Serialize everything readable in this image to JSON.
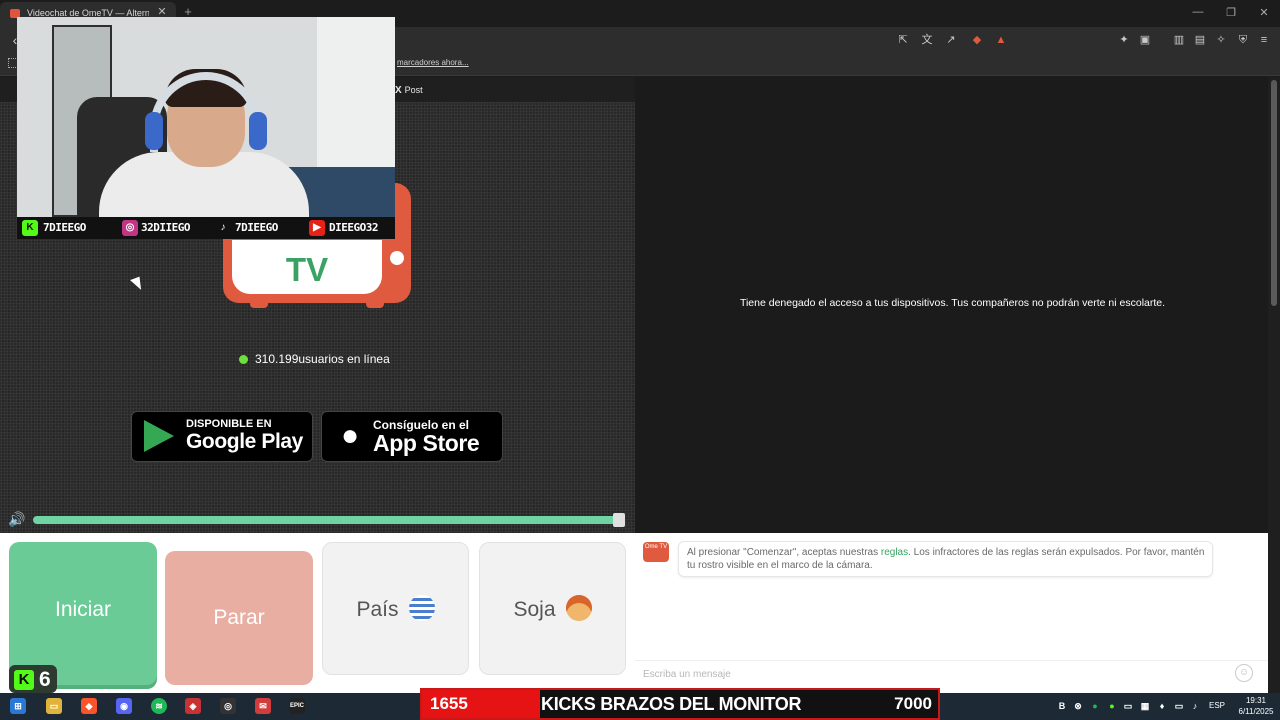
{
  "browser": {
    "tab_title": "Videochat de OmeTV — Alterna",
    "tab_close": "✕",
    "new_tab": "+",
    "back": "‹",
    "bookmark_text": "marcadores ahora...",
    "window_controls": [
      "—",
      "❐",
      "✕"
    ]
  },
  "page": {
    "x_post_logo": "X",
    "x_post_label": "Post",
    "online_count_text": "310.199usuarios en línea",
    "logo_text": "TV",
    "google_play": {
      "small": "DISPONIBLE EN",
      "big": "Google Play"
    },
    "app_store": {
      "small": "Consíguelo en el",
      "big": "App Store"
    },
    "volume_icon": "🔊",
    "volume_level_percent": 100,
    "access_denied_text": "Tiene denegado el acceso a tus dispositivos. Tus compañeros no podrán verte ni escolarte."
  },
  "overlay": {
    "socials": [
      {
        "icon": "kick-icon",
        "icon_glyph": "K",
        "handle": "7DIEEGO",
        "color": "#53fc18"
      },
      {
        "icon": "instagram-icon",
        "icon_glyph": "◎",
        "handle": "32DIIEGO",
        "color": "#c13584"
      },
      {
        "icon": "tiktok-icon",
        "icon_glyph": "♪",
        "handle": "7DIEEGO",
        "color": "#111111"
      },
      {
        "icon": "youtube-icon",
        "icon_glyph": "▶",
        "handle": "DIEEGO32",
        "color": "#e62117"
      }
    ],
    "kick_badge_number": "6",
    "kick_badge_glyph": "K"
  },
  "controls": {
    "start_label": "Iniciar",
    "stop_label": "Parar",
    "country_label": "País",
    "gender_label": "Soja"
  },
  "chat": {
    "logo_text": "Ome TV",
    "message_before_link": "Al presionar \"Comenzar\", aceptas nuestras ",
    "message_link": "reglas",
    "message_after_link": ". Los infractores de las reglas serán expulsados. Por favor, mantén tu rostro visible en el marco de la cámara.",
    "input_placeholder": "Escriba un mensaje",
    "emoji_glyph": "☺"
  },
  "ticker": {
    "left_value": "1655",
    "title": "KICKS BRAZOS DEL MONITOR",
    "right_value": "7000"
  },
  "taskbar": {
    "language": "ESP",
    "time": "19:31",
    "date": "6/11/2025",
    "epic_label": "EPIC"
  },
  "colors": {
    "accent_green": "#6acb96",
    "stop_red": "#e9aea2",
    "brand_orange": "#e05a3f",
    "ticker_red": "#e51313",
    "kick_green": "#53fc18"
  }
}
